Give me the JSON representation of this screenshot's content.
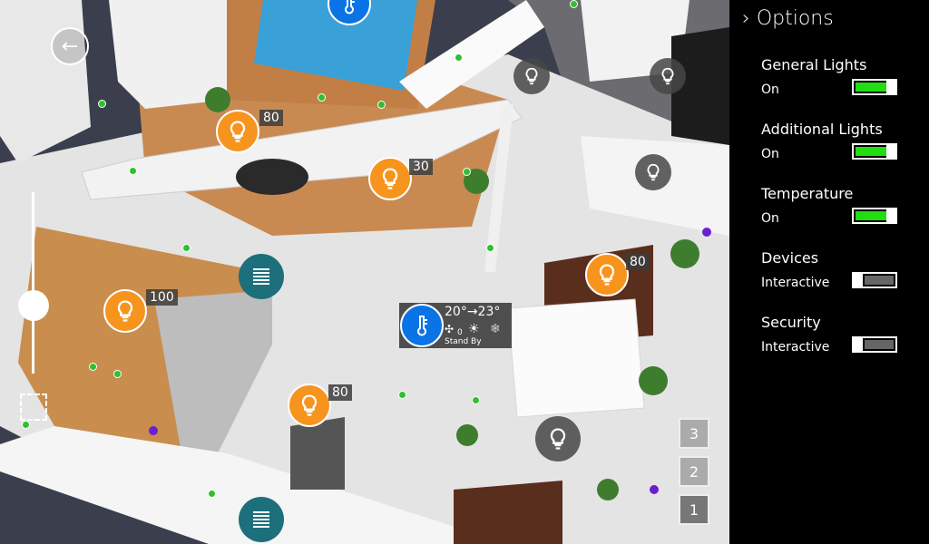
{
  "panel": {
    "title": "Options",
    "options": [
      {
        "name": "General Lights",
        "state": "On",
        "enabled": true
      },
      {
        "name": "Additional Lights",
        "state": "On",
        "enabled": true
      },
      {
        "name": "Temperature",
        "state": "On",
        "enabled": true
      },
      {
        "name": "Devices",
        "state": "Interactive",
        "enabled": false
      },
      {
        "name": "Security",
        "state": "Interactive",
        "enabled": false
      }
    ]
  },
  "lights": {
    "terrace_left": "80",
    "terrace_right": "30",
    "living": "80",
    "kitchen": "100",
    "dining": "80"
  },
  "thermostat": {
    "range": "20°→23°",
    "fan_speed": "0",
    "mode": "Stand By"
  },
  "floors": [
    "3",
    "2",
    "1"
  ],
  "active_floor": "1",
  "colors": {
    "light_on": "#f7941d",
    "thermostat": "#0a73e6",
    "blind": "#1d6f7c",
    "toggle_on": "#22dd11",
    "panel_bg": "#000000"
  }
}
